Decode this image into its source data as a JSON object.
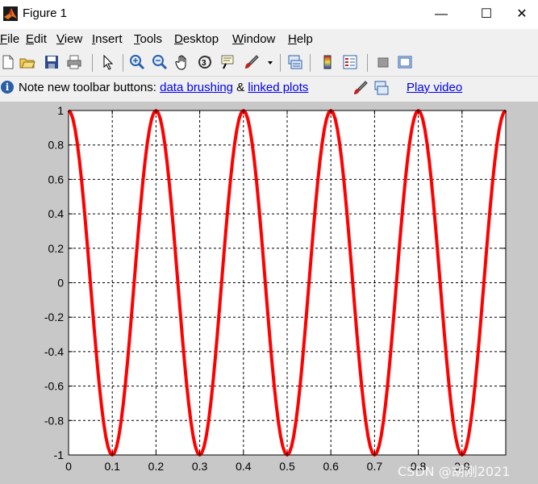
{
  "window": {
    "title": "Figure 1",
    "minimize": "—",
    "maximize": "☐",
    "close": "✕"
  },
  "menu": [
    {
      "key": "F",
      "rest": "ile"
    },
    {
      "key": "E",
      "rest": "dit"
    },
    {
      "key": "V",
      "rest": "iew"
    },
    {
      "key": "I",
      "rest": "nsert"
    },
    {
      "key": "T",
      "rest": "ools"
    },
    {
      "key": "D",
      "rest": "esktop"
    },
    {
      "key": "W",
      "rest": "indow"
    },
    {
      "key": "H",
      "rest": "elp"
    }
  ],
  "toolbar_icons": [
    "new-file-icon",
    "open-folder-icon",
    "save-icon",
    "print-icon",
    "pointer-icon",
    "zoom-in-icon",
    "zoom-out-icon",
    "pan-hand-icon",
    "rotate-3d-icon",
    "data-cursor-icon",
    "brush-icon",
    "brush-dropdown-icon",
    "link-plot-icon",
    "colorbar-icon",
    "legend-icon",
    "hide-plot-tools-icon",
    "show-plot-tools-icon"
  ],
  "infobar": {
    "note": "Note new toolbar buttons: ",
    "link1": "data brushing",
    "amp": " & ",
    "link2": "linked plots",
    "link3": "Play video"
  },
  "watermark": "CSDN @胡刚2021",
  "chart_data": {
    "type": "line",
    "function": "cos(10*pi*x)",
    "x_range": [
      0,
      1
    ],
    "xlim": [
      0,
      1
    ],
    "ylim": [
      -1,
      1
    ],
    "xticks": [
      0,
      0.1,
      0.2,
      0.3,
      0.4,
      0.5,
      0.6,
      0.7,
      0.8,
      0.9
    ],
    "yticks": [
      1,
      0.8,
      0.6,
      0.4,
      0.2,
      0,
      -0.2,
      -0.4,
      -0.6,
      -0.8,
      -1
    ],
    "xtick_labels": [
      "0",
      "0.1",
      "0.2",
      "0.3",
      "0.4",
      "0.5",
      "0.6",
      "0.7",
      "0.8",
      "0.9"
    ],
    "ytick_labels": [
      "1",
      "0.8",
      "0.6",
      "0.4",
      "0.2",
      "0",
      "-0.2",
      "-0.4",
      "-0.6",
      "-0.8",
      "-1"
    ],
    "grid": true,
    "line_color": "#ff0000",
    "series": [
      {
        "samples": 200
      }
    ]
  }
}
